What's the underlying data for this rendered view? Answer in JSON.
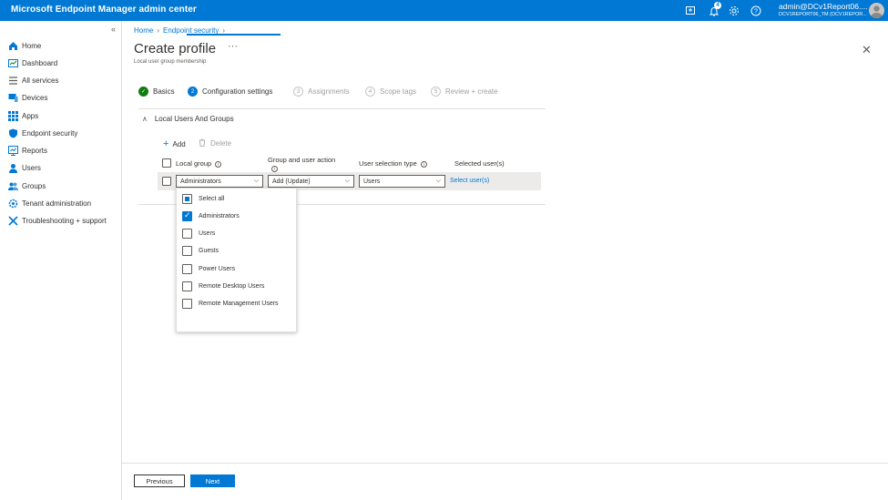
{
  "topbar": {
    "title": "Microsoft Endpoint Manager admin center",
    "notification_count": "4",
    "account_name": "admin@DCv1Report06....",
    "tenant": "DCV1REPORT06_TM (DCV1REPOR..."
  },
  "sidebar": {
    "collapse": "«",
    "items": [
      {
        "label": "Home",
        "icon": "home-icon"
      },
      {
        "label": "Dashboard",
        "icon": "dashboard-icon"
      },
      {
        "label": "All services",
        "icon": "list-icon"
      },
      {
        "label": "Devices",
        "icon": "devices-icon"
      },
      {
        "label": "Apps",
        "icon": "apps-icon"
      },
      {
        "label": "Endpoint security",
        "icon": "shield-icon"
      },
      {
        "label": "Reports",
        "icon": "reports-icon"
      },
      {
        "label": "Users",
        "icon": "user-icon"
      },
      {
        "label": "Groups",
        "icon": "groups-icon"
      },
      {
        "label": "Tenant administration",
        "icon": "gear-icon"
      },
      {
        "label": "Troubleshooting + support",
        "icon": "tools-icon"
      }
    ]
  },
  "breadcrumb": {
    "home": "Home",
    "section": "Endpoint security"
  },
  "page": {
    "title": "Create profile",
    "more": "···",
    "subtitle": "Local user group membership",
    "close": "✕"
  },
  "steps": [
    {
      "num": "✓",
      "label": "Basics",
      "state": "done"
    },
    {
      "num": "2",
      "label": "Configuration settings",
      "state": "active"
    },
    {
      "num": "3",
      "label": "Assignments",
      "state": "pending"
    },
    {
      "num": "4",
      "label": "Scope tags",
      "state": "pending"
    },
    {
      "num": "5",
      "label": "Review + create",
      "state": "pending"
    }
  ],
  "section": {
    "title": "Local Users And Groups",
    "chevron": "∧"
  },
  "toolbar": {
    "add": "Add",
    "delete": "Delete"
  },
  "table": {
    "headers": {
      "local_group": "Local group",
      "group_action": "Group and user action",
      "user_selection": "User selection type",
      "selected_users": "Selected user(s)"
    },
    "row": {
      "local_group": "Administrators",
      "action": "Add (Update)",
      "selection": "Users",
      "link": "Select user(s)"
    }
  },
  "dropdown_options": [
    {
      "label": "Select all",
      "state": "partial"
    },
    {
      "label": "Administrators",
      "state": "checked"
    },
    {
      "label": "Users",
      "state": "unchecked"
    },
    {
      "label": "Guests",
      "state": "unchecked"
    },
    {
      "label": "Power Users",
      "state": "unchecked"
    },
    {
      "label": "Remote Desktop Users",
      "state": "unchecked"
    },
    {
      "label": "Remote Management Users",
      "state": "unchecked"
    }
  ],
  "footer": {
    "previous": "Previous",
    "next": "Next"
  },
  "colors": {
    "accent": "#0078d4",
    "success": "#107c10"
  }
}
